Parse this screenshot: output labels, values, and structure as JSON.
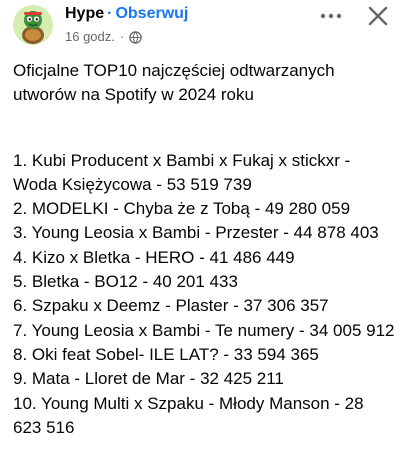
{
  "post": {
    "author": "Hype",
    "separator": "·",
    "follow_label": "Obserwuj",
    "time": "16 godz.",
    "meta_separator": "·",
    "privacy_icon": "globe-icon",
    "intro": "Oficjalne TOP10 najczęściej odtwarzanych utworów na Spotify w 2024 roku",
    "flag_icon": "poland-flag",
    "items": [
      "1. Kubi Producent x Bambi x Fukaj x stickxr - Woda Księżycowa - 53 519 739",
      "2. MODELKI - Chyba że z Tobą - 49 280 059",
      "3. Young Leosia x Bambi - Przester - 44 878 403",
      "4. Kizo x Bletka - HERO - 41 486 449",
      "5. Bletka  - BO12 - 40 201 433",
      "6. Szpaku x Deemz - Plaster - 37 306 357",
      "7. Young Leosia x Bambi - Te numery - 34 005 912",
      "8. Oki feat Sobel- ILE LAT? - 33 594 365",
      "9. Mata - Lloret de Mar - 32 425 211",
      "10. Young Multi x Szpaku - Młody Manson - 28 623 516"
    ]
  },
  "colors": {
    "accent": "#1877f2",
    "meta_text": "#65676b",
    "text": "#050505"
  }
}
